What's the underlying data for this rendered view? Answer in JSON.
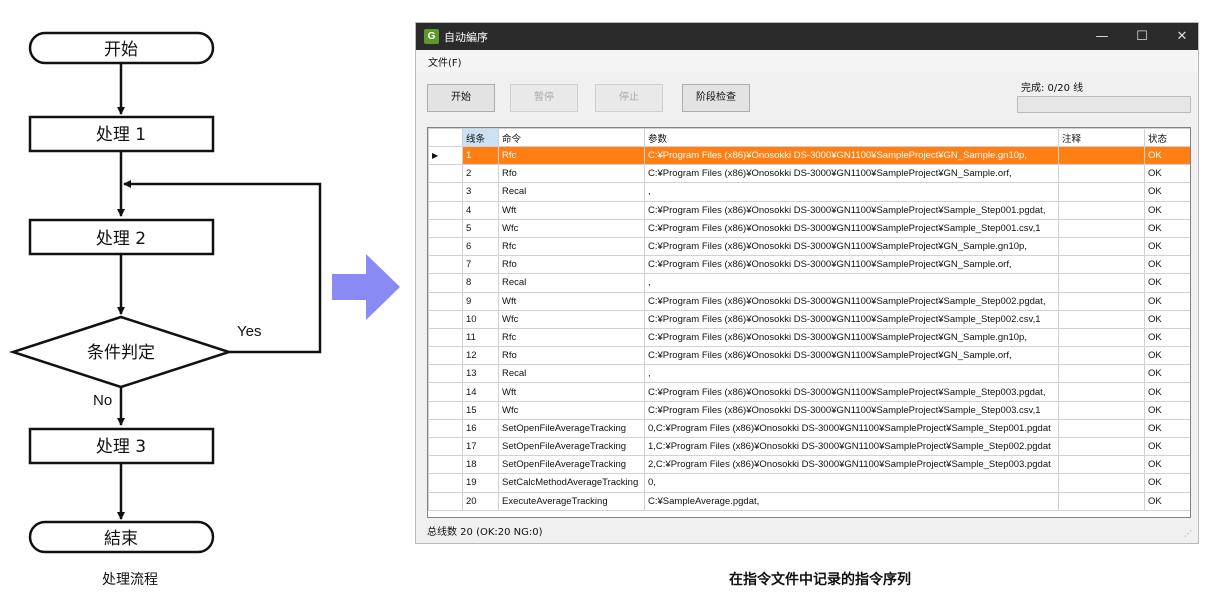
{
  "flowchart": {
    "start_label": "开始",
    "process1_label": "处理 1",
    "process2_label": "处理 2",
    "decision_label": "条件判定",
    "yes_label": "Yes",
    "no_label": "No",
    "process3_label": "处理 3",
    "end_label": "結束",
    "caption": "处理流程"
  },
  "window": {
    "title": "自动編序",
    "app_icon": "app-icon",
    "minimize_icon": "—",
    "maximize_icon": "☐",
    "close_icon": "✕",
    "menu_file": "文件(F)",
    "buttons": {
      "start": "开始",
      "pause": "暂停",
      "stop": "停止",
      "step": "阶段检查"
    },
    "progress_label": "完成: 0/20 线",
    "progress_fraction": 0,
    "columns": [
      "线条",
      "命令",
      "参数",
      "注释",
      "状态"
    ],
    "selected_marker": "▶",
    "rows": [
      {
        "no": "1",
        "cmd": "Rfc",
        "param": "C:¥Program Files (x86)¥Onosokki DS-3000¥GN1100¥SampleProject¥GN_Sample.gn10p,",
        "note": "",
        "status": "OK"
      },
      {
        "no": "2",
        "cmd": "Rfo",
        "param": "C:¥Program Files (x86)¥Onosokki DS-3000¥GN1100¥SampleProject¥GN_Sample.orf,",
        "note": "",
        "status": "OK"
      },
      {
        "no": "3",
        "cmd": "Recal",
        "param": ",",
        "note": "",
        "status": "OK"
      },
      {
        "no": "4",
        "cmd": "Wft",
        "param": "C:¥Program Files (x86)¥Onosokki DS-3000¥GN1100¥SampleProject¥Sample_Step001.pgdat,",
        "note": "",
        "status": "OK"
      },
      {
        "no": "5",
        "cmd": "Wfc",
        "param": "C:¥Program Files (x86)¥Onosokki DS-3000¥GN1100¥SampleProject¥Sample_Step001.csv,1",
        "note": "",
        "status": "OK"
      },
      {
        "no": "6",
        "cmd": "Rfc",
        "param": "C:¥Program Files (x86)¥Onosokki DS-3000¥GN1100¥SampleProject¥GN_Sample.gn10p,",
        "note": "",
        "status": "OK"
      },
      {
        "no": "7",
        "cmd": "Rfo",
        "param": "C:¥Program Files (x86)¥Onosokki DS-3000¥GN1100¥SampleProject¥GN_Sample.orf,",
        "note": "",
        "status": "OK"
      },
      {
        "no": "8",
        "cmd": "Recal",
        "param": ",",
        "note": "",
        "status": "OK"
      },
      {
        "no": "9",
        "cmd": "Wft",
        "param": "C:¥Program Files (x86)¥Onosokki DS-3000¥GN1100¥SampleProject¥Sample_Step002.pgdat,",
        "note": "",
        "status": "OK"
      },
      {
        "no": "10",
        "cmd": "Wfc",
        "param": "C:¥Program Files (x86)¥Onosokki DS-3000¥GN1100¥SampleProject¥Sample_Step002.csv,1",
        "note": "",
        "status": "OK"
      },
      {
        "no": "11",
        "cmd": "Rfc",
        "param": "C:¥Program Files (x86)¥Onosokki DS-3000¥GN1100¥SampleProject¥GN_Sample.gn10p,",
        "note": "",
        "status": "OK"
      },
      {
        "no": "12",
        "cmd": "Rfo",
        "param": "C:¥Program Files (x86)¥Onosokki DS-3000¥GN1100¥SampleProject¥GN_Sample.orf,",
        "note": "",
        "status": "OK"
      },
      {
        "no": "13",
        "cmd": "Recal",
        "param": ",",
        "note": "",
        "status": "OK"
      },
      {
        "no": "14",
        "cmd": "Wft",
        "param": "C:¥Program Files (x86)¥Onosokki DS-3000¥GN1100¥SampleProject¥Sample_Step003.pgdat,",
        "note": "",
        "status": "OK"
      },
      {
        "no": "15",
        "cmd": "Wfc",
        "param": "C:¥Program Files (x86)¥Onosokki DS-3000¥GN1100¥SampleProject¥Sample_Step003.csv,1",
        "note": "",
        "status": "OK"
      },
      {
        "no": "16",
        "cmd": "SetOpenFileAverageTracking",
        "param": "0,C:¥Program Files (x86)¥Onosokki DS-3000¥GN1100¥SampleProject¥Sample_Step001.pgdat",
        "note": "",
        "status": "OK"
      },
      {
        "no": "17",
        "cmd": "SetOpenFileAverageTracking",
        "param": "1,C:¥Program Files (x86)¥Onosokki DS-3000¥GN1100¥SampleProject¥Sample_Step002.pgdat",
        "note": "",
        "status": "OK"
      },
      {
        "no": "18",
        "cmd": "SetOpenFileAverageTracking",
        "param": "2,C:¥Program Files (x86)¥Onosokki DS-3000¥GN1100¥SampleProject¥Sample_Step003.pgdat",
        "note": "",
        "status": "OK"
      },
      {
        "no": "19",
        "cmd": "SetCalcMethodAverageTracking",
        "param": "0,",
        "note": "",
        "status": "OK"
      },
      {
        "no": "20",
        "cmd": "ExecuteAverageTracking",
        "param": "C:¥SampleAverage.pgdat,",
        "note": "",
        "status": "OK"
      }
    ],
    "status_bar": "总线数 20 (OK:20 NG:0)",
    "caption": "在指令文件中记录的指令序列"
  },
  "colors": {
    "selected_row": "#ff7f14",
    "arrow": "#8a8af5",
    "title_bar": "#2b2b2b"
  }
}
